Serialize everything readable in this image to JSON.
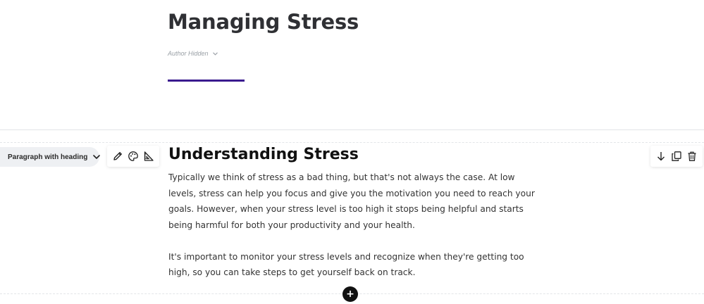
{
  "lesson": {
    "title": "Managing Stress",
    "author": "Author Hidden",
    "accent_color": "#3a1a8f"
  },
  "block": {
    "type_label": "Paragraph with heading",
    "heading": "Understanding Stress",
    "paragraphs": [
      "Typically we think of stress as a bad thing, but that's not always the case. At low levels, stress can help you focus and give you the motivation you need to reach your goals. However, when your stress level is too high it stops being helpful and starts being harmful for both your productivity and your health.",
      "It's important to monitor your stress levels and recognize when they're getting too high, so you can take steps to get yourself back on track."
    ]
  },
  "toolbar_left": {
    "icons": [
      "pencil-icon",
      "palette-icon",
      "set-square-icon"
    ]
  },
  "toolbar_right": {
    "icons": [
      "arrow-down-icon",
      "duplicate-icon",
      "trash-icon"
    ]
  },
  "add_block": {
    "label": "+"
  }
}
